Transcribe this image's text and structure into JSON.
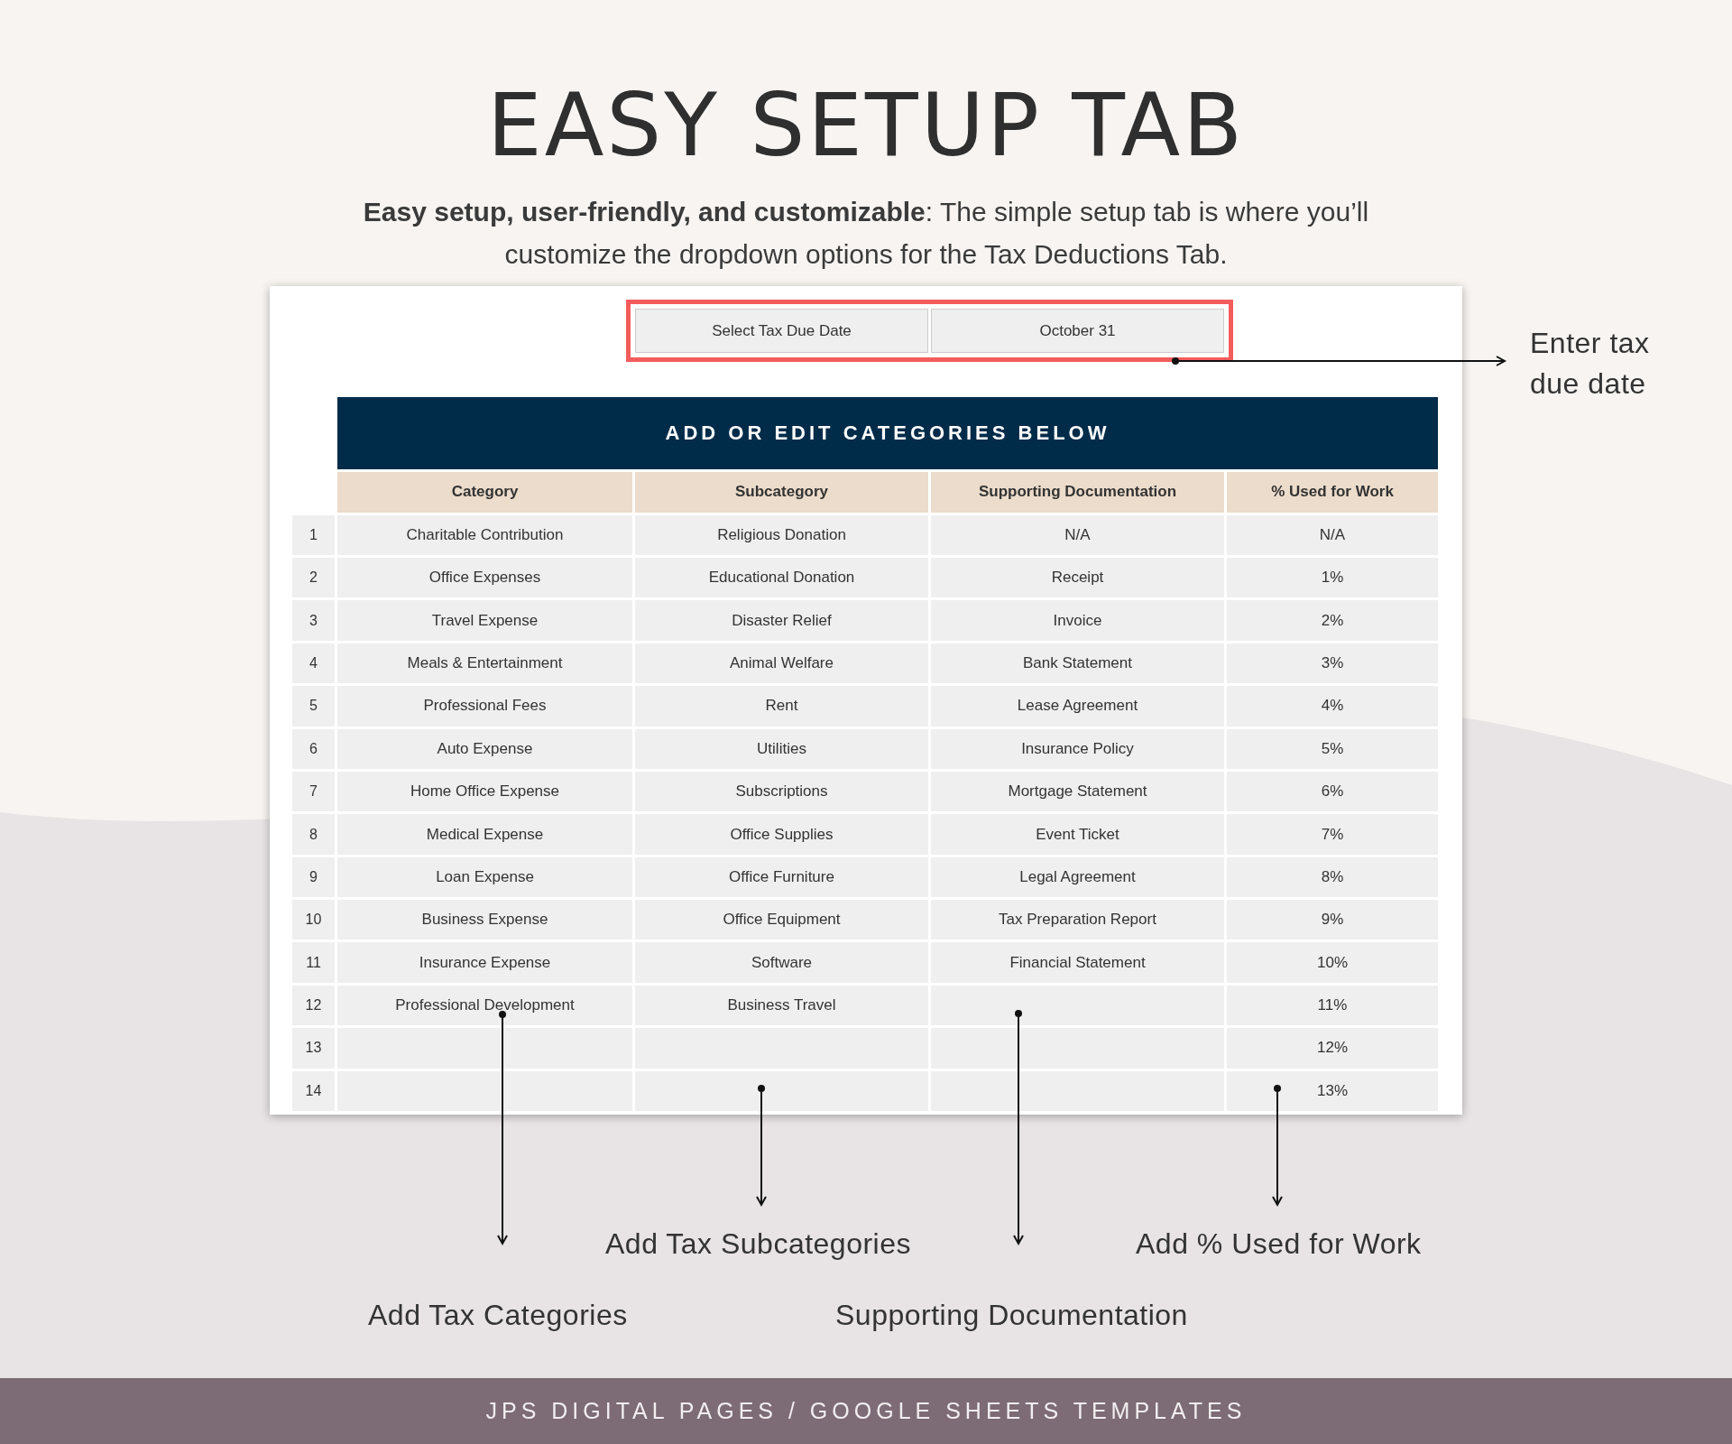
{
  "title": "EASY SETUP TAB",
  "subtitle": "**Easy setup, user-friendly, and customizable**: The simple setup tab is where you’ll customize the dropdown options for the Tax Deductions Tab.",
  "sheet": {
    "date_field": {
      "label": "Select Tax Due Date",
      "value": "October 31"
    },
    "banner": "ADD OR EDIT CATEGORIES BELOW",
    "columns": [
      "Category",
      "Subcategory",
      "Supporting Documentation",
      "% Used for Work"
    ],
    "rows": [
      {
        "number": "1",
        "category": "Charitable Contribution",
        "subcategory": "Religious Donation",
        "documentation": "N/A",
        "percent": "N/A"
      },
      {
        "number": "2",
        "category": "Office Expenses",
        "subcategory": "Educational Donation",
        "documentation": "Receipt",
        "percent": "1%"
      },
      {
        "number": "3",
        "category": "Travel Expense",
        "subcategory": "Disaster Relief",
        "documentation": "Invoice",
        "percent": "2%"
      },
      {
        "number": "4",
        "category": "Meals & Entertainment",
        "subcategory": "Animal Welfare",
        "documentation": "Bank Statement",
        "percent": "3%"
      },
      {
        "number": "5",
        "category": "Professional Fees",
        "subcategory": "Rent",
        "documentation": "Lease Agreement",
        "percent": "4%"
      },
      {
        "number": "6",
        "category": "Auto Expense",
        "subcategory": "Utilities",
        "documentation": "Insurance Policy",
        "percent": "5%"
      },
      {
        "number": "7",
        "category": "Home Office Expense",
        "subcategory": "Subscriptions",
        "documentation": "Mortgage Statement",
        "percent": "6%"
      },
      {
        "number": "8",
        "category": "Medical Expense",
        "subcategory": "Office Supplies",
        "documentation": "Event Ticket",
        "percent": "7%"
      },
      {
        "number": "9",
        "category": "Loan Expense",
        "subcategory": "Office Furniture",
        "documentation": "Legal Agreement",
        "percent": "8%"
      },
      {
        "number": "10",
        "category": "Business Expense",
        "subcategory": "Office Equipment",
        "documentation": "Tax Preparation Report",
        "percent": "9%"
      },
      {
        "number": "11",
        "category": "Insurance Expense",
        "subcategory": "Software",
        "documentation": "Financial Statement",
        "percent": "10%"
      },
      {
        "number": "12",
        "category": "Professional Development",
        "subcategory": "Business Travel",
        "percent": "11%"
      },
      {
        "number": "13",
        "percent": "12%"
      },
      {
        "number": "14",
        "percent": "13%"
      }
    ]
  },
  "annotations": [
    {
      "text": "Enter tax due date"
    },
    {
      "text": "Add Tax Categories"
    },
    {
      "text": "Add Tax Subcategories"
    },
    {
      "text": "Supporting Documentation"
    },
    {
      "text": "Add % Used for Work"
    }
  ],
  "footer": "JPS DIGITAL PAGES / GOOGLE SHEETS TEMPLATES"
}
